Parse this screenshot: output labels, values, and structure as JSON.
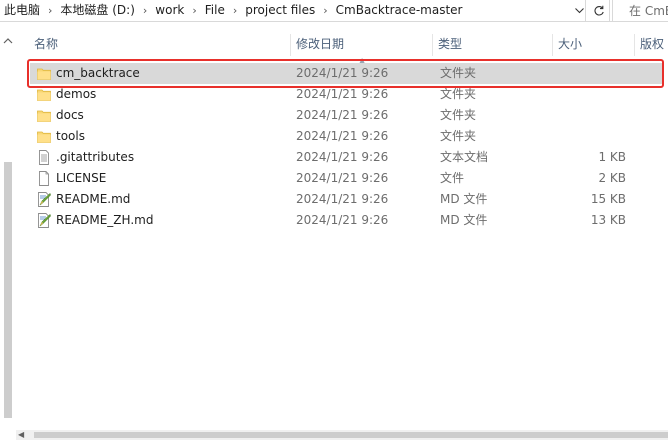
{
  "breadcrumb": [
    "此电脑",
    "本地磁盘 (D:)",
    "work",
    "File",
    "project files",
    "CmBacktrace-master"
  ],
  "search": {
    "placeholder": "在 CmBacktrace-master 中搜索"
  },
  "columns": {
    "name": "名称",
    "modified": "修改日期",
    "type": "类型",
    "size": "大小",
    "version": "版权"
  },
  "files": [
    {
      "name": "cm_backtrace",
      "date": "2024/1/21 9:26",
      "type": "文件夹",
      "size": "",
      "icon": "folder-icon",
      "selected": true
    },
    {
      "name": "demos",
      "date": "2024/1/21 9:26",
      "type": "文件夹",
      "size": "",
      "icon": "folder-icon"
    },
    {
      "name": "docs",
      "date": "2024/1/21 9:26",
      "type": "文件夹",
      "size": "",
      "icon": "folder-icon"
    },
    {
      "name": "tools",
      "date": "2024/1/21 9:26",
      "type": "文件夹",
      "size": "",
      "icon": "folder-icon"
    },
    {
      "name": ".gitattributes",
      "date": "2024/1/21 9:26",
      "type": "文本文档",
      "size": "1 KB",
      "icon": "text-file-icon"
    },
    {
      "name": "LICENSE",
      "date": "2024/1/21 9:26",
      "type": "文件",
      "size": "2 KB",
      "icon": "blank-file-icon"
    },
    {
      "name": "README.md",
      "date": "2024/1/21 9:26",
      "type": "MD 文件",
      "size": "15 KB",
      "icon": "markdown-file-icon"
    },
    {
      "name": "README_ZH.md",
      "date": "2024/1/21 9:26",
      "type": "MD 文件",
      "size": "13 KB",
      "icon": "markdown-file-icon"
    }
  ],
  "colors": {
    "selection": "#d9d9d9",
    "highlight_border": "#e8302b",
    "folder": "#f8d775",
    "header_text": "#4c607a"
  }
}
